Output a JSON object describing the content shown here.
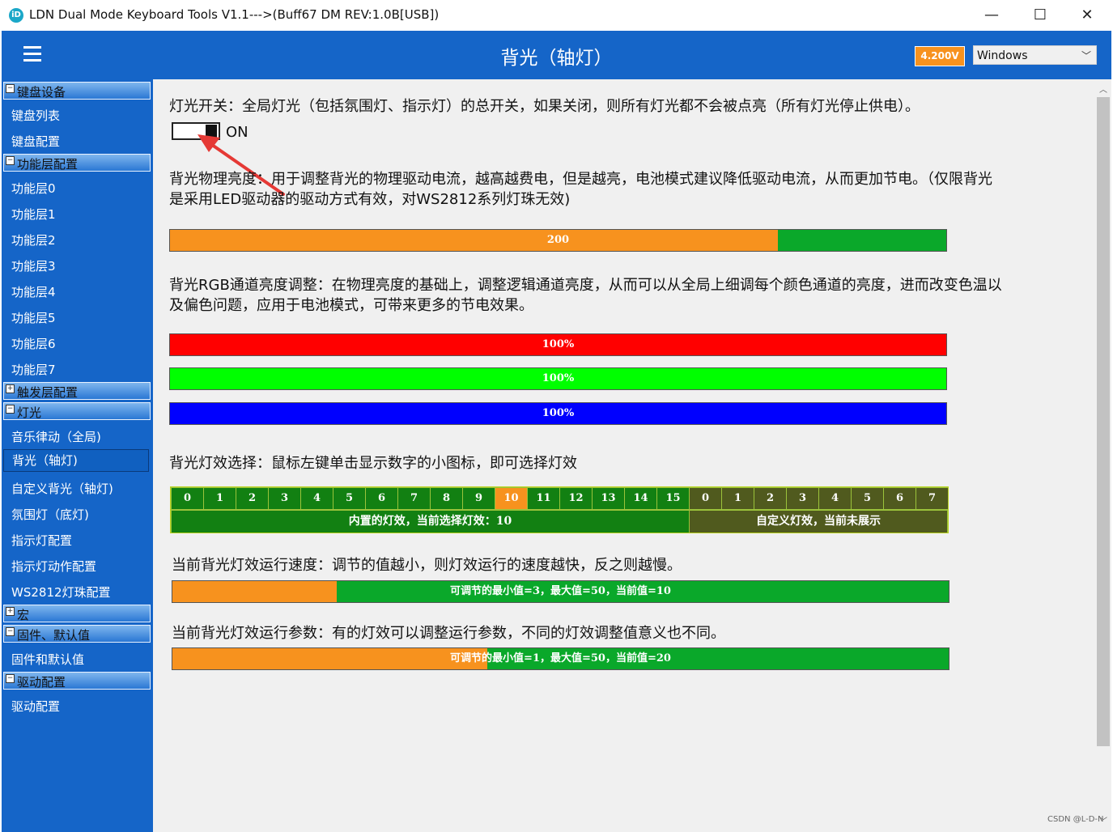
{
  "window": {
    "title": "LDN Dual Mode Keyboard Tools V1.1--->(Buff67 DM REV:1.0B[USB])",
    "minimize": "—",
    "maximize": "☐",
    "close": "✕"
  },
  "header": {
    "title": "背光（轴灯）",
    "voltage": "4.200V",
    "os": "Windows"
  },
  "sidebar": {
    "groups": [
      {
        "toggle": "⊟",
        "label": "键盘设备",
        "items": [
          "键盘列表",
          "键盘配置"
        ]
      },
      {
        "toggle": "⊟",
        "label": "功能层配置",
        "items": [
          "功能层0",
          "功能层1",
          "功能层2",
          "功能层3",
          "功能层4",
          "功能层5",
          "功能层6",
          "功能层7"
        ]
      },
      {
        "toggle": "⊞",
        "label": "触发层配置",
        "items": []
      },
      {
        "toggle": "⊟",
        "label": "灯光",
        "items": [
          "音乐律动（全局)",
          "背光（轴灯)",
          "自定义背光（轴灯)",
          "氛围灯（底灯)",
          "指示灯配置",
          "指示灯动作配置",
          "WS2812灯珠配置"
        ]
      },
      {
        "toggle": "⊞",
        "label": "宏",
        "items": []
      },
      {
        "toggle": "⊟",
        "label": "固件、默认值",
        "items": [
          "固件和默认值"
        ]
      },
      {
        "toggle": "⊟",
        "label": "驱动配置",
        "items": [
          "驱动配置"
        ]
      }
    ],
    "selected": "背光（轴灯)"
  },
  "main": {
    "power_desc": "灯光开关：全局灯光（包括氛围灯、指示灯）的总开关，如果关闭，则所有灯光都不会被点亮（所有灯光停止供电）。",
    "power_state": "ON",
    "brightness_desc_1": "背光物理亮度：用于调整背光的物理驱动电流，越高越费电，但是越亮，电池模式建议降低驱动电流，从而更加节电。（仅限背光",
    "brightness_desc_2": "是采用LED驱动器的驱动方式有效，对WS2812系列灯珠无效)",
    "brightness": {
      "label": "200",
      "fraction": 0.783
    },
    "rgb_desc_1": "背光RGB通道亮度调整：在物理亮度的基础上，调整逻辑通道亮度，从而可以从全局上细调每个颜色通道的亮度，进而改变色温以",
    "rgb_desc_2": "及偏色问题，应用于电池模式，可带来更多的节电效果。",
    "rgb": [
      {
        "label": "100%",
        "color": "#ff0000"
      },
      {
        "label": "100%",
        "color": "#00ff00"
      },
      {
        "label": "100%",
        "color": "#0000ff"
      }
    ],
    "effect_desc": "背光灯效选择：鼠标左键单击显示数字的小图标，即可选择灯效",
    "builtin_effects": [
      "0",
      "1",
      "2",
      "3",
      "4",
      "5",
      "6",
      "7",
      "8",
      "9",
      "10",
      "11",
      "12",
      "13",
      "14",
      "15"
    ],
    "custom_effects": [
      "0",
      "1",
      "2",
      "3",
      "4",
      "5",
      "6",
      "7"
    ],
    "selected_effect": "10",
    "builtin_label": "内置的灯效，当前选择灯效：10",
    "custom_label": "自定义灯效，当前未展示",
    "speed_desc": "当前背光灯效运行速度：调节的值越小，则灯效运行的速度越快，反之则越慢。",
    "speed": {
      "label": "可调节的最小值=3，最大值=50，当前值=10",
      "fraction": 0.212
    },
    "param_desc": "当前背光灯效运行参数：有的灯效可以调整运行参数，不同的灯效调整值意义也不同。",
    "param": {
      "label": "可调节的最小值=1，最大值=50，当前值=20",
      "fraction": 0.406
    }
  },
  "colors": {
    "accent": "#1565c8",
    "orange": "#f7921e",
    "green": "#0aa82a"
  },
  "watermark": "CSDN @L-D-N"
}
